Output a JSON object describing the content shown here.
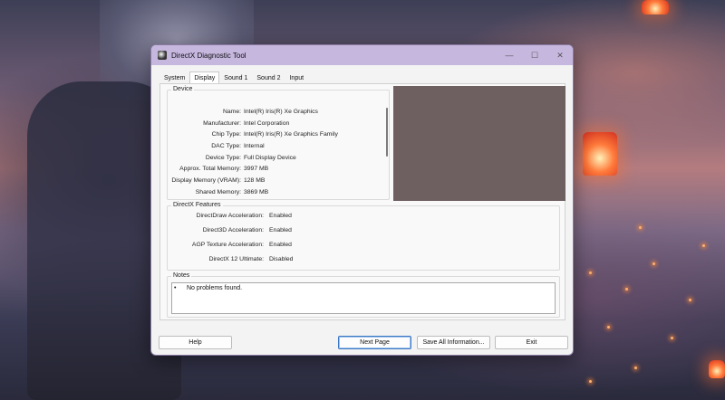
{
  "window": {
    "title": "DirectX Diagnostic Tool",
    "controls": {
      "minimize": "—",
      "maximize": "☐",
      "close": "✕"
    }
  },
  "tabs": [
    {
      "label": "System",
      "active": false
    },
    {
      "label": "Display",
      "active": true
    },
    {
      "label": "Sound 1",
      "active": false
    },
    {
      "label": "Sound 2",
      "active": false
    },
    {
      "label": "Input",
      "active": false
    }
  ],
  "device": {
    "group_label": "Device",
    "rows": [
      {
        "label": "Name:",
        "value": "Intel(R) Iris(R) Xe Graphics"
      },
      {
        "label": "Manufacturer:",
        "value": "Intel Corporation"
      },
      {
        "label": "Chip Type:",
        "value": "Intel(R) Iris(R) Xe Graphics Family"
      },
      {
        "label": "DAC Type:",
        "value": "Internal"
      },
      {
        "label": "Device Type:",
        "value": "Full Display Device"
      },
      {
        "label": "Approx. Total Memory:",
        "value": "3997 MB"
      },
      {
        "label": "Display Memory (VRAM):",
        "value": "128 MB"
      },
      {
        "label": "Shared Memory:",
        "value": "3869 MB"
      }
    ]
  },
  "directx_features": {
    "group_label": "DirectX Features",
    "rows": [
      {
        "label": "DirectDraw Acceleration:",
        "value": "Enabled"
      },
      {
        "label": "Direct3D Acceleration:",
        "value": "Enabled"
      },
      {
        "label": "AGP Texture Acceleration:",
        "value": "Enabled"
      },
      {
        "label": "DirectX 12 Ultimate:",
        "value": "Disabled"
      }
    ]
  },
  "notes": {
    "group_label": "Notes",
    "lines": [
      {
        "bullet": "•",
        "text": "No problems found."
      }
    ]
  },
  "buttons": {
    "help": "Help",
    "next_page": "Next Page",
    "save_all": "Save All Information...",
    "exit": "Exit"
  },
  "colors": {
    "titlebar": "#c6b7df",
    "preview": "#6e5f60",
    "default_button_border": "#3b78c4"
  }
}
